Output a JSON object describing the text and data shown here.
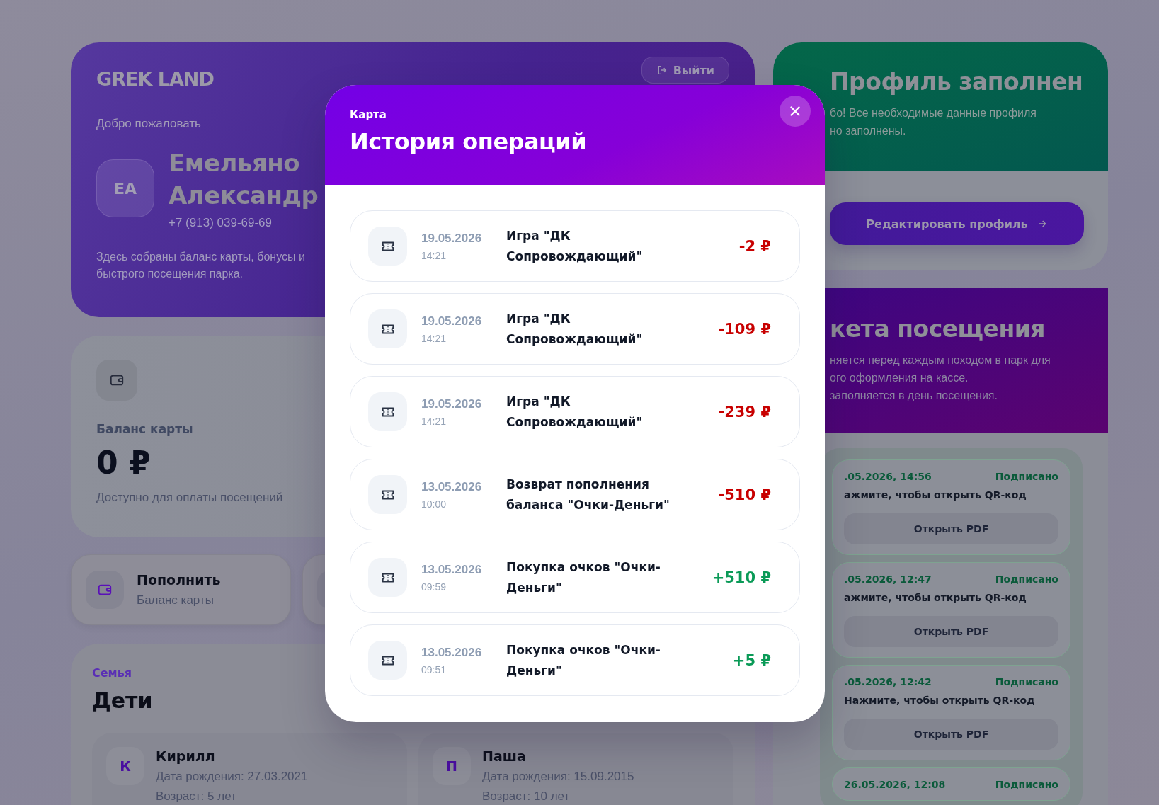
{
  "hero": {
    "logo": "GREK LAND",
    "logout_button": "Выйти",
    "welcome": "Добро пожаловать",
    "avatar": "EA",
    "name_lines": [
      "Емельяно",
      "Александр"
    ],
    "phone": "+7 (913) 039-69-69",
    "intro_lines": [
      "Здесь собраны баланс карты, бонусы и",
      "быстрого посещения парка."
    ]
  },
  "balance": {
    "label": "Баланс карты",
    "amount": "0 ₽",
    "note": "Доступно для оплаты посещений"
  },
  "actions": [
    {
      "title": "Пополнить",
      "subtitle": "Баланс карты"
    }
  ],
  "family": {
    "eyebrow": "Семья",
    "title": "Дети",
    "children": [
      {
        "initial": "К",
        "name": "Кирилл",
        "birth": "Дата рождения: 27.03.2021",
        "age": "Возраст: 5 лет"
      },
      {
        "initial": "П",
        "name": "Паша",
        "birth": "Дата рождения: 15.09.2015",
        "age": "Возраст: 10 лет"
      }
    ]
  },
  "profile": {
    "title": "Профиль заполнен",
    "text_lines": [
      "бо! Все необходимые данные профиля",
      "но заполнены."
    ],
    "button": "Редактировать профиль"
  },
  "visit_form": {
    "title": "кета посещения",
    "text_lines": [
      "няется перед каждым походом в парк для",
      "ого оформления на кассе.",
      "заполняется в день посещения."
    ],
    "forms": [
      {
        "datetime": ".05.2026, 14:56",
        "status": "Подписано",
        "hint": "ажмите, чтобы открыть QR-код",
        "pdf_button": "Открыть PDF"
      },
      {
        "datetime": ".05.2026, 12:47",
        "status": "Подписано",
        "hint": "ажмите, чтобы открыть QR-код",
        "pdf_button": "Открыть PDF"
      },
      {
        "datetime": ".05.2026, 12:42",
        "status": "Подписано",
        "hint": "Нажмите, чтобы открыть QR-код",
        "pdf_button": "Открыть PDF"
      },
      {
        "datetime": "26.05.2026, 12:08",
        "status": "Подписано"
      }
    ]
  },
  "modal": {
    "eyebrow": "Карта",
    "title": "История операций",
    "operations": [
      {
        "date": "19.05.2026",
        "time": "14:21",
        "title": "Игра \"ДК Сопровождающий\"",
        "amount": "-2 ₽",
        "kind": "expense"
      },
      {
        "date": "19.05.2026",
        "time": "14:21",
        "title": "Игра \"ДК Сопровождающий\"",
        "amount": "-109 ₽",
        "kind": "expense"
      },
      {
        "date": "19.05.2026",
        "time": "14:21",
        "title": "Игра \"ДК Сопровождающий\"",
        "amount": "-239 ₽",
        "kind": "expense"
      },
      {
        "date": "13.05.2026",
        "time": "10:00",
        "title": "Возврат пополнения баланса \"Очки-Деньги\"",
        "amount": "-510 ₽",
        "kind": "expense"
      },
      {
        "date": "13.05.2026",
        "time": "09:59",
        "title": "Покупка очков \"Очки-Деньги\"",
        "amount": "+510 ₽",
        "kind": "income"
      },
      {
        "date": "13.05.2026",
        "time": "09:51",
        "title": "Покупка очков \"Очки-Деньги\"",
        "amount": "+5 ₽",
        "kind": "income"
      }
    ]
  }
}
